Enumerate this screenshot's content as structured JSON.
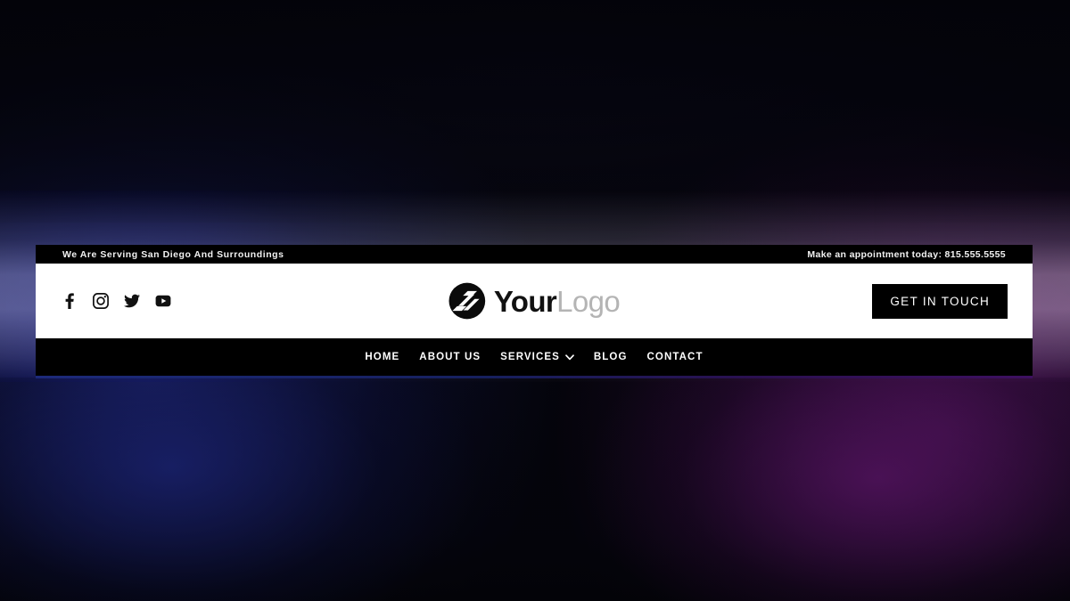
{
  "theme": {
    "header_bar_bg": "#000000",
    "header_main_bg": "#ffffff",
    "accent_text": "#ffffff",
    "logo_gray": "#b4b4b4",
    "bg_blue": "#1e2676",
    "bg_purple": "#5c1668"
  },
  "topbar": {
    "left_text": "We Are Serving San Diego And Surroundings",
    "right_text": "Make an appointment today: 815.555.5555"
  },
  "social": {
    "items": [
      {
        "name": "facebook",
        "label": "Facebook"
      },
      {
        "name": "instagram",
        "label": "Instagram"
      },
      {
        "name": "twitter",
        "label": "Twitter"
      },
      {
        "name": "youtube",
        "label": "YouTube"
      }
    ]
  },
  "brand": {
    "mark": "swoosh-circle-logo",
    "name_bold": "Your",
    "name_light": "Logo"
  },
  "cta": {
    "label": "GET IN TOUCH"
  },
  "nav": {
    "items": [
      {
        "label": "HOME",
        "has_dropdown": false
      },
      {
        "label": "ABOUT US",
        "has_dropdown": false
      },
      {
        "label": "SERVICES",
        "has_dropdown": true
      },
      {
        "label": "BLOG",
        "has_dropdown": false
      },
      {
        "label": "CONTACT",
        "has_dropdown": false
      }
    ]
  }
}
